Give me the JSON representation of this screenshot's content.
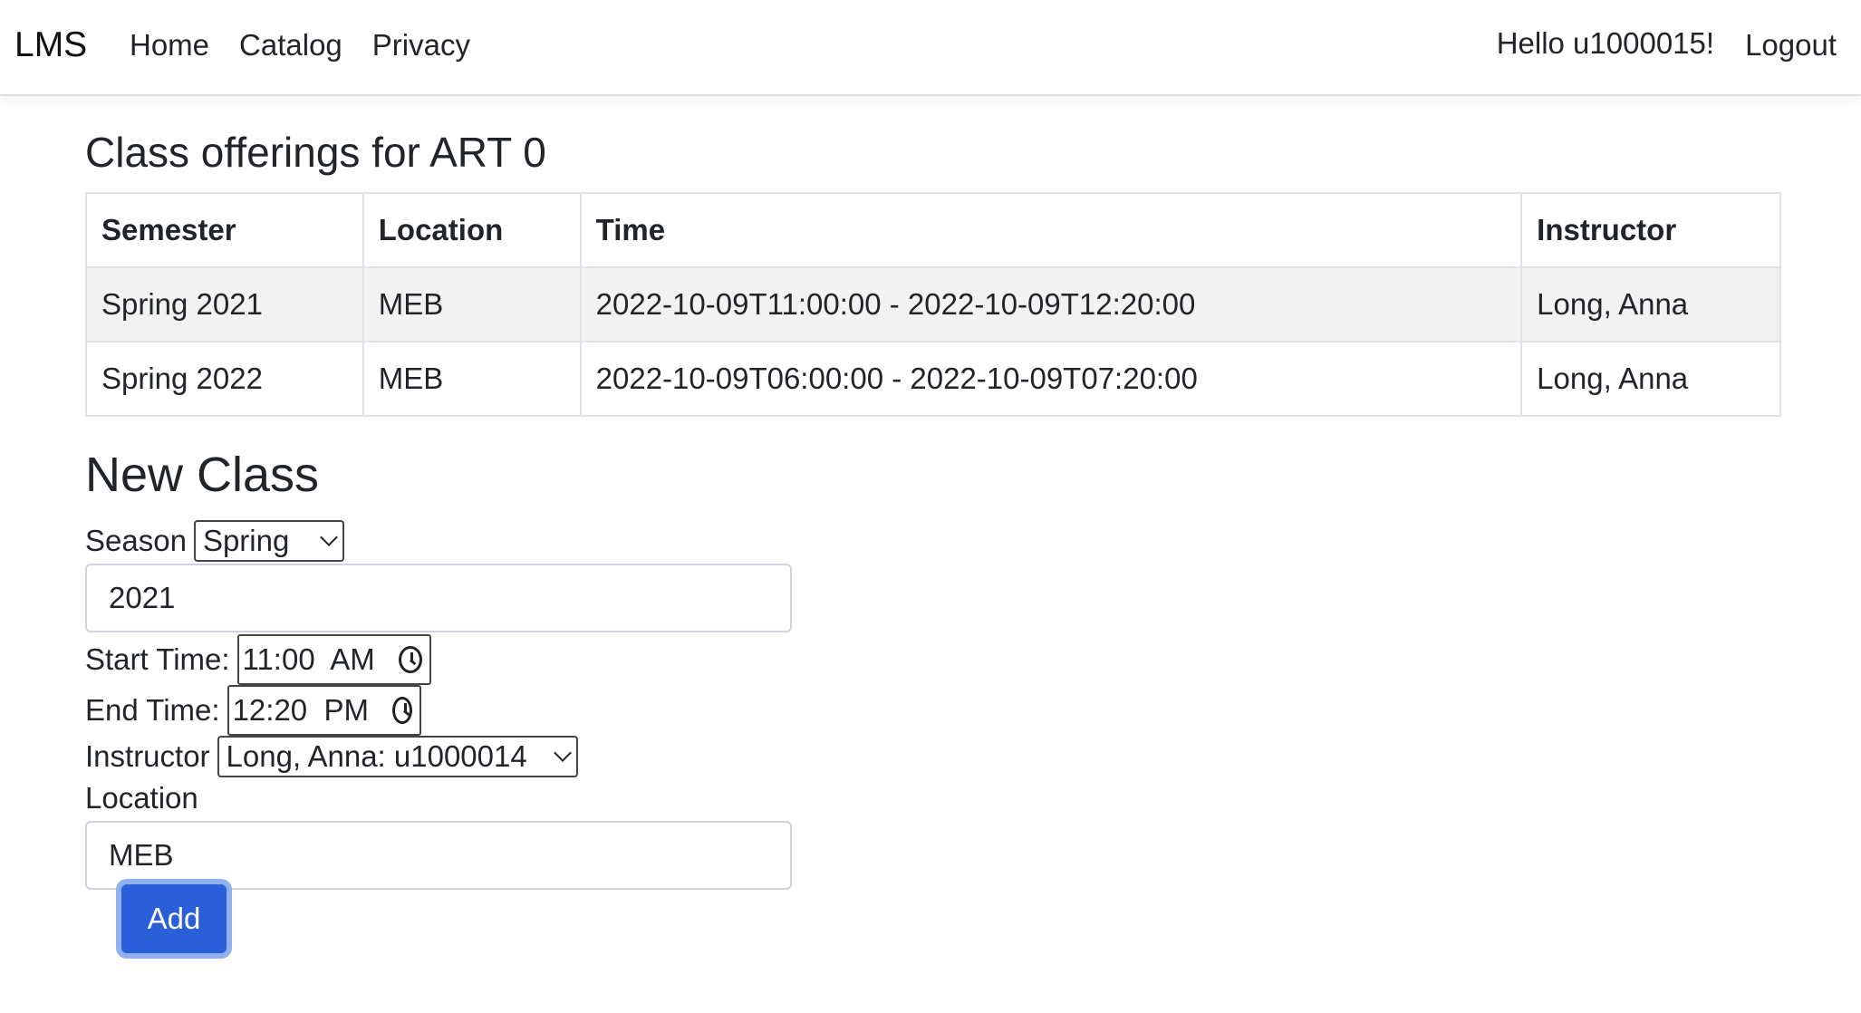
{
  "nav": {
    "brand": "LMS",
    "links": [
      "Home",
      "Catalog",
      "Privacy"
    ],
    "greeting": "Hello u1000015!",
    "logout": "Logout"
  },
  "offerings": {
    "title": "Class offerings for ART 0",
    "columns": [
      "Semester",
      "Location",
      "Time",
      "Instructor"
    ],
    "rows": [
      {
        "semester": "Spring 2021",
        "location": "MEB",
        "time": "2022-10-09T11:00:00 - 2022-10-09T12:20:00",
        "instructor": "Long, Anna"
      },
      {
        "semester": "Spring 2022",
        "location": "MEB",
        "time": "2022-10-09T06:00:00 - 2022-10-09T07:20:00",
        "instructor": "Long, Anna"
      }
    ]
  },
  "new_class": {
    "title": "New Class",
    "season_label": "Season",
    "season_value": "Spring",
    "year_value": "2021",
    "start_label": "Start Time:",
    "start_value": "11:00  AM",
    "end_label": "End Time:",
    "end_value": "12:20  PM",
    "instructor_label": "Instructor",
    "instructor_value": "Long, Anna: u1000014",
    "location_label": "Location",
    "location_value": "MEB",
    "add_button": "Add"
  },
  "icons": {
    "select_arrow": "chevron-down-icon",
    "time_picker": "clock-icon"
  },
  "colors": {
    "primary_button": "#2b5fd9",
    "striped_row": "#f2f2f2"
  }
}
